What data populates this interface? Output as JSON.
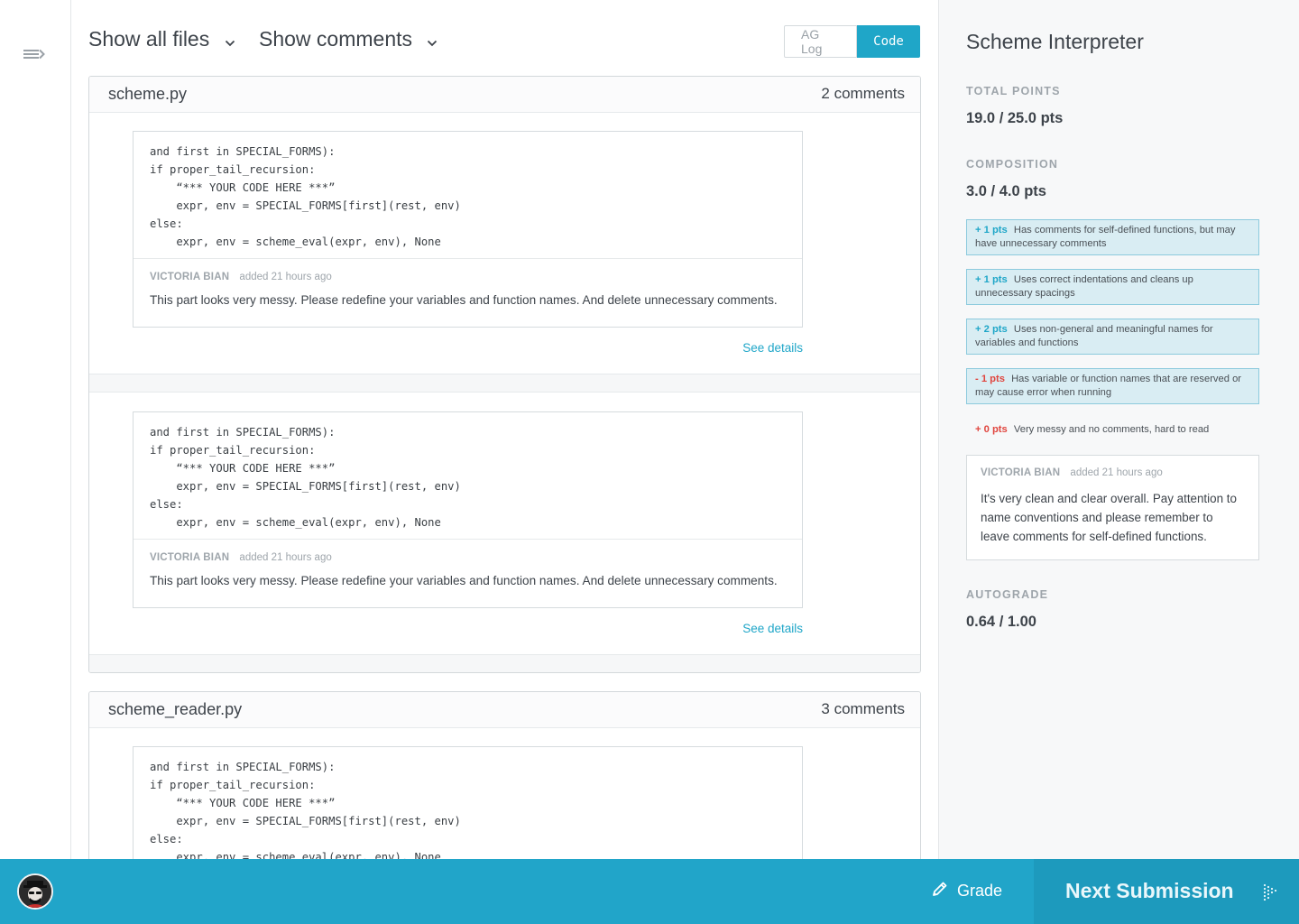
{
  "toolbar": {
    "files_filter": "Show all files",
    "comments_filter": "Show comments",
    "ag_log_label": "AG Log",
    "code_label": "Code"
  },
  "files": [
    {
      "name": "scheme.py",
      "comment_count": "2 comments",
      "snippets": [
        {
          "code": "and first in SPECIAL_FORMS):\nif proper_tail_recursion:\n    “*** YOUR CODE HERE ***”\n    expr, env = SPECIAL_FORMS[first](rest, env)\nelse:\n    expr, env = scheme_eval(expr, env), None",
          "author": "VICTORIA BIAN",
          "time": "added 21 hours ago",
          "comment": "This part looks very messy. Please redefine your variables and function names. And delete unnecessary comments.",
          "see_details": "See details"
        },
        {
          "code": "and first in SPECIAL_FORMS):\nif proper_tail_recursion:\n    “*** YOUR CODE HERE ***”\n    expr, env = SPECIAL_FORMS[first](rest, env)\nelse:\n    expr, env = scheme_eval(expr, env), None",
          "author": "VICTORIA BIAN",
          "time": "added 21 hours ago",
          "comment": "This part looks very messy. Please redefine your variables and function names. And delete unnecessary comments.",
          "see_details": "See details"
        }
      ]
    },
    {
      "name": "scheme_reader.py",
      "comment_count": "3 comments",
      "snippets": [
        {
          "code": "and first in SPECIAL_FORMS):\nif proper_tail_recursion:\n    “*** YOUR CODE HERE ***”\n    expr, env = SPECIAL_FORMS[first](rest, env)\nelse:\n    expr, env = scheme_eval(expr, env), None"
        }
      ]
    }
  ],
  "panel": {
    "title": "Scheme Interpreter",
    "total_label": "TOTAL POINTS",
    "total_value": "19.0 / 25.0 pts",
    "composition_label": "COMPOSITION",
    "composition_value": "3.0 / 4.0 pts",
    "rubric": [
      {
        "pts": "+ 1 pts",
        "text": "Has comments for self-defined functions, but may have unnecessary comments",
        "selected": true,
        "sign": "pos"
      },
      {
        "pts": "+ 1 pts",
        "text": "Uses correct indentations and cleans up unnecessary spacings",
        "selected": true,
        "sign": "pos"
      },
      {
        "pts": "+ 2 pts",
        "text": "Uses non-general and meaningful names for variables and functions",
        "selected": true,
        "sign": "pos"
      },
      {
        "pts": "- 1 pts",
        "text": "Has variable or function names that are reserved or may cause error when running",
        "selected": true,
        "sign": "neg"
      },
      {
        "pts": "+ 0 pts",
        "text": "Very messy and no comments, hard to read",
        "selected": false,
        "sign": "neg"
      }
    ],
    "overall_comment": {
      "author": "VICTORIA BIAN",
      "time": "added 21 hours ago",
      "text": "It's very clean and clear overall. Pay attention to name conventions and please remember to leave comments for self-defined functions."
    },
    "autograde_label": "AUTOGRADE",
    "autograde_value": "0.64 / 1.00"
  },
  "bottom": {
    "grade_label": "Grade",
    "next_label": "Next Submission"
  },
  "colors": {
    "accent": "#1fa6c8",
    "bottom_bar": "#21a5c9",
    "negative": "#e0453e",
    "selected_rubric_bg": "#d9edf3"
  },
  "icons": [
    "sidebar-toggle-icon",
    "chevron-down-icon",
    "pencil-icon",
    "next-arrow-icon",
    "avatar"
  ]
}
